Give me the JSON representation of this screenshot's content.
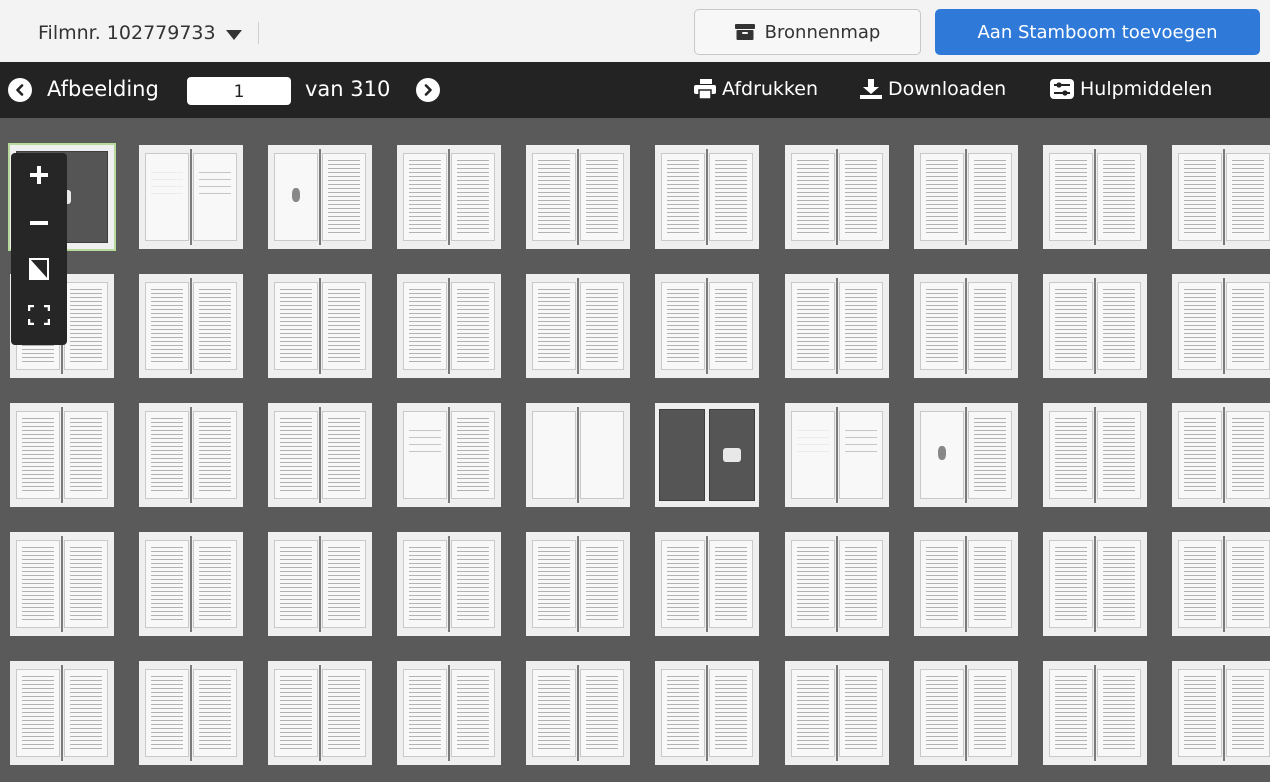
{
  "header": {
    "film_label": "Filmnr. 102779733",
    "film_caret_icon": "caret-down-icon",
    "source_button_label": "Bronnenmap",
    "source_button_icon": "archive-box-icon",
    "add_button_label": "Aan Stamboom toevoegen",
    "add_button_color": "#2f7ad9"
  },
  "toolbar": {
    "image_label": "Afbeelding",
    "current_page": "1",
    "total_label": "van 310",
    "prev_icon": "chevron-left-icon",
    "next_icon": "chevron-right-icon",
    "print_label": "Afdrukken",
    "print_icon": "printer-icon",
    "download_label": "Downloaden",
    "download_icon": "download-icon",
    "tools_label": "Hulpmiddelen",
    "tools_icon": "sliders-icon"
  },
  "zoom_controls": {
    "zoom_in_icon": "plus-icon",
    "zoom_out_icon": "minus-icon",
    "fit_icon": "page-fold-icon",
    "fullscreen_icon": "fullscreen-icon"
  },
  "grid": {
    "columns": 10,
    "selected_index": 0,
    "thumbnails": [
      {
        "kind": "closed-cover"
      },
      {
        "kind": "title-page"
      },
      {
        "kind": "seal-page"
      },
      {
        "kind": "text"
      },
      {
        "kind": "text"
      },
      {
        "kind": "text"
      },
      {
        "kind": "text"
      },
      {
        "kind": "text"
      },
      {
        "kind": "text"
      },
      {
        "kind": "text"
      },
      {
        "kind": "text"
      },
      {
        "kind": "text"
      },
      {
        "kind": "text"
      },
      {
        "kind": "text"
      },
      {
        "kind": "text"
      },
      {
        "kind": "text"
      },
      {
        "kind": "text"
      },
      {
        "kind": "text"
      },
      {
        "kind": "text"
      },
      {
        "kind": "text"
      },
      {
        "kind": "text"
      },
      {
        "kind": "text"
      },
      {
        "kind": "text"
      },
      {
        "kind": "sparse-text"
      },
      {
        "kind": "blank"
      },
      {
        "kind": "open-cover"
      },
      {
        "kind": "title-page"
      },
      {
        "kind": "seal-page"
      },
      {
        "kind": "text"
      },
      {
        "kind": "text"
      },
      {
        "kind": "text"
      },
      {
        "kind": "text"
      },
      {
        "kind": "text"
      },
      {
        "kind": "text"
      },
      {
        "kind": "text"
      },
      {
        "kind": "text"
      },
      {
        "kind": "text"
      },
      {
        "kind": "text"
      },
      {
        "kind": "text"
      },
      {
        "kind": "text"
      },
      {
        "kind": "text"
      },
      {
        "kind": "text"
      },
      {
        "kind": "text"
      },
      {
        "kind": "text"
      },
      {
        "kind": "text"
      },
      {
        "kind": "text"
      },
      {
        "kind": "text"
      },
      {
        "kind": "text"
      },
      {
        "kind": "text"
      },
      {
        "kind": "text"
      }
    ]
  }
}
